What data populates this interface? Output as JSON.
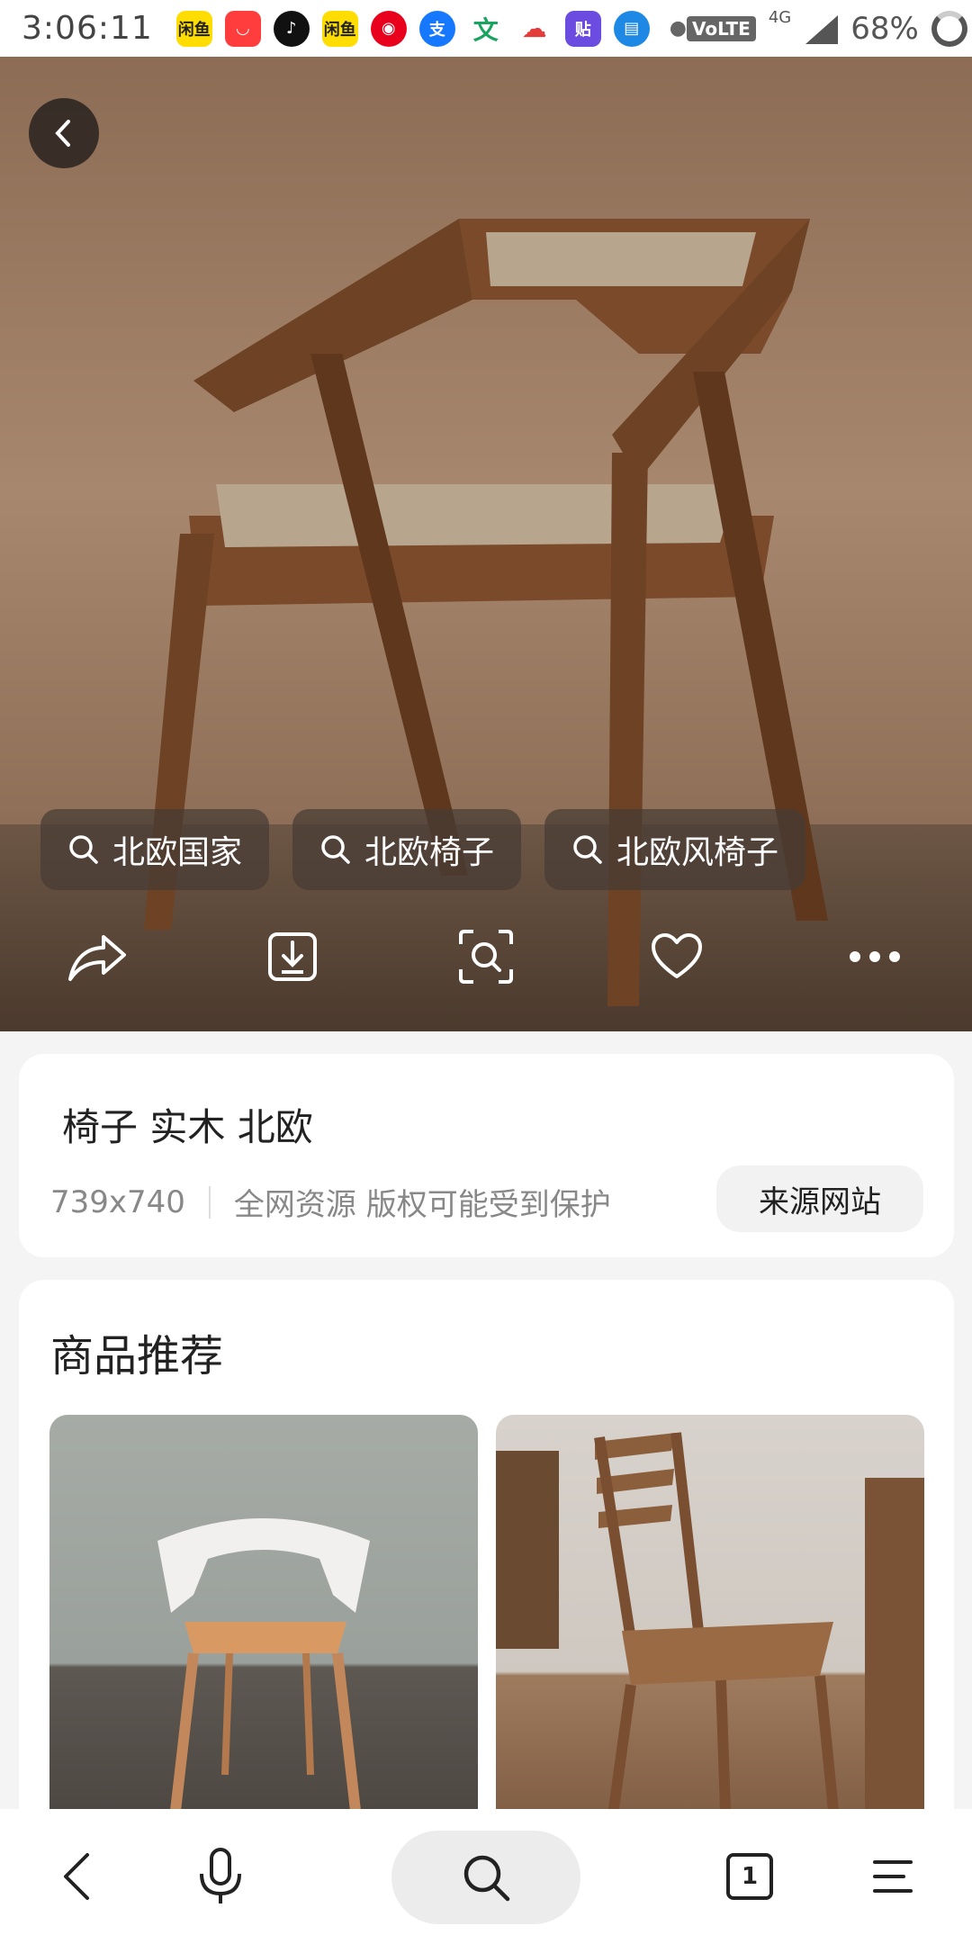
{
  "status_bar": {
    "time": "3:06:11",
    "network_label": "VoLTE",
    "network_type": "4G",
    "battery": "68%",
    "notification_icons": [
      {
        "name": "xianyu-icon",
        "label": "闲鱼",
        "color": "#ffdd00"
      },
      {
        "name": "taobao-icon",
        "label": "",
        "color": "#ff3d3d"
      },
      {
        "name": "tiktok-icon",
        "label": "",
        "color": "#111111"
      },
      {
        "name": "xianyu-icon-2",
        "label": "闲鱼",
        "color": "#ffdd00"
      },
      {
        "name": "app-red-icon",
        "label": "",
        "color": "#e8001c"
      },
      {
        "name": "alipay-icon",
        "label": "支",
        "color": "#1677ff"
      },
      {
        "name": "wen-icon",
        "label": "文",
        "color": "#1aa260"
      },
      {
        "name": "cloud-icon",
        "label": "",
        "color": "#e43b3b"
      },
      {
        "name": "tieba-icon",
        "label": "贴",
        "color": "#6a4de0"
      },
      {
        "name": "blue-app-icon",
        "label": "",
        "color": "#1e88e5"
      }
    ]
  },
  "hero": {
    "search_chips": [
      "北欧国家",
      "北欧椅子",
      "北欧风椅子"
    ]
  },
  "info": {
    "title": "椅子 实木 北欧",
    "dimensions": "739x740",
    "copyright": "全网资源 版权可能受到保护",
    "source_button": "来源网站"
  },
  "products": {
    "section_title": "商品推荐"
  },
  "bottom_nav": {
    "tab_count": "1"
  }
}
